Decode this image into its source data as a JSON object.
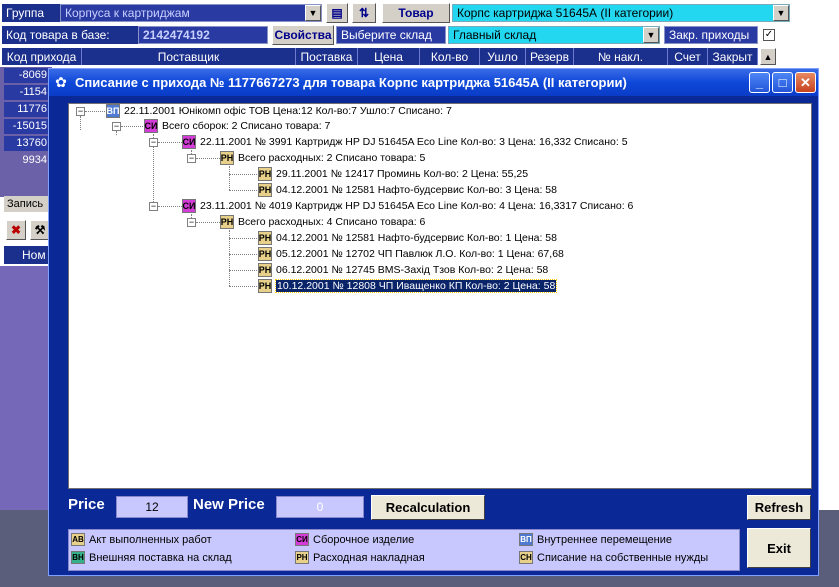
{
  "background": {
    "group_label": "Группа",
    "group_value": "Корпуса к картриджам",
    "product_button": "Товар",
    "product_value": "Корпс картриджа 51645А (II категории)",
    "code_label": "Код товара в базе:",
    "code_value": "2142474192",
    "properties_button": "Свойства",
    "warehouse_label": "Выберите склад",
    "warehouse_value": "Главный склад",
    "closed_receipts_label": "Закр. приходы",
    "columns": [
      "Код прихода",
      "Поставщик",
      "Поставка",
      "Цена",
      "Кол-во",
      "Ушло",
      "Резерв",
      "№ накл.",
      "Счет",
      "Закрыт"
    ],
    "left_codes": [
      "-8069",
      "-1154",
      "11776",
      "-15015",
      "13760",
      "9934"
    ],
    "left_tab": "Запись",
    "left_header": "Ном"
  },
  "dialog": {
    "title": "Списание с прихода № 1177667273 для товара Корпс картриджа 51645А (II категории)",
    "tree": [
      {
        "icon_text": "ВП",
        "text": "22.11.2001  Юнікомп офіс ТОВ  Цена:12  Кол-во:7  Ушло:7 Списано: 7"
      },
      {
        "icon_text": "СИ",
        "text": "Всего сборок: 2 Списано товара: 7"
      },
      {
        "icon_text": "СИ",
        "text": "22.11.2001  № 3991  Картридж HP DJ 51645A Eco Line Кол-во: 3 Цена: 16,332 Списано: 5"
      },
      {
        "icon_text": "РН",
        "text": "Всего расходных: 2 Списано товара: 5"
      },
      {
        "icon_text": "РН",
        "text": "29.11.2001  № 12417  Проминь Кол-во: 2 Цена: 55,25"
      },
      {
        "icon_text": "РН",
        "text": "04.12.2001  № 12581  Нафто-будсервис Кол-во: 3 Цена: 58"
      },
      {
        "icon_text": "СИ",
        "text": "23.11.2001  № 4019  Картридж HP DJ 51645A Eco Line Кол-во: 4 Цена: 16,3317 Списано: 6"
      },
      {
        "icon_text": "РН",
        "text": "Всего расходных: 4 Списано товара: 6"
      },
      {
        "icon_text": "РН",
        "text": "04.12.2001  № 12581  Нафто-будсервис Кол-во: 1 Цена: 58"
      },
      {
        "icon_text": "РН",
        "text": "05.12.2001  № 12702  ЧП Павлюк Л.О. Кол-во: 1 Цена: 67,68"
      },
      {
        "icon_text": "РН",
        "text": "06.12.2001  № 12745  BMS-Захід Тзов Кол-во: 2 Цена: 58"
      },
      {
        "icon_text": "РН",
        "text": "10.12.2001  № 12808  ЧП Иващенко КП Кол-во: 2 Цена: 58"
      }
    ],
    "price_label": "Price",
    "price_value": "12",
    "new_price_label": "New Price",
    "new_price_value": "0",
    "recalc_button": "Recalculation",
    "refresh_button": "Refresh",
    "exit_button": "Exit",
    "legend": [
      {
        "icon_text": "АВ",
        "label": "Акт выполненных работ",
        "color": "#e7d08a"
      },
      {
        "icon_text": "СИ",
        "label": "Сборочное изделие",
        "color": "#d43cd8"
      },
      {
        "icon_text": "ВП",
        "label": "Внутреннее перемещение",
        "color": "#4f7ad1"
      },
      {
        "icon_text": "ВН",
        "label": "Внешняя поставка на склад",
        "color": "#35b08a"
      },
      {
        "icon_text": "РН",
        "label": "Расходная накладная",
        "color": "#e7d08a"
      },
      {
        "icon_text": "СН",
        "label": "Списание на собственные нужды",
        "color": "#e7d08a"
      }
    ]
  }
}
